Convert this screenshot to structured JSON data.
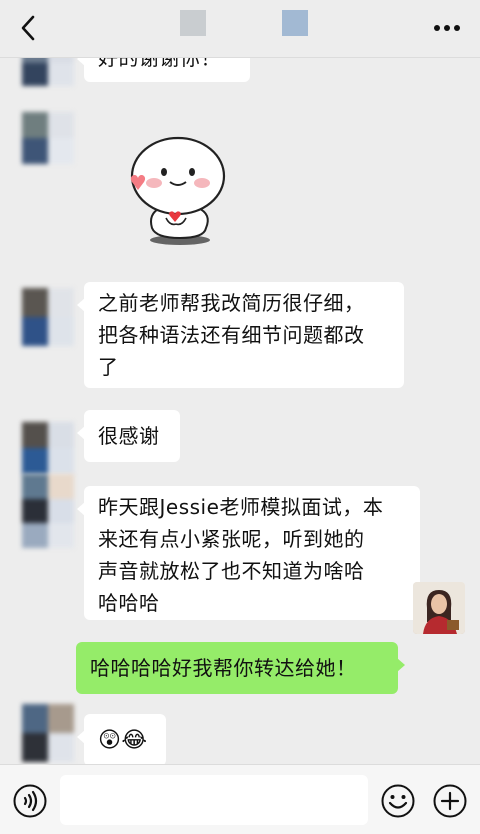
{
  "header": {
    "back_icon": "chevron-left-icon",
    "more_icon": "ellipsis-icon"
  },
  "messages": [
    {
      "side": "left",
      "type": "text",
      "text": "好的谢谢你！"
    },
    {
      "side": "left",
      "type": "sticker",
      "sticker": "cute-bun-heart-sticker"
    },
    {
      "side": "left",
      "type": "text",
      "text": "之前老师帮我改简历很仔细，把各种语法还有细节问题都改了"
    },
    {
      "side": "left",
      "type": "text",
      "text": "很感谢"
    },
    {
      "side": "left",
      "type": "text",
      "text": "昨天跟Jessie老师模拟面试，本来还有点小紧张呢，听到她的声音就放松了也不知道为啥哈哈哈哈"
    },
    {
      "side": "right",
      "type": "text",
      "text": "哈哈哈哈好我帮你转达给她！"
    },
    {
      "side": "left",
      "type": "emoji",
      "text": "😲😂"
    }
  ],
  "bubble_lines": {
    "m0": [
      "好的谢谢你！"
    ],
    "m2": [
      "之前老师帮我改简历很仔细，",
      "把各种语法还有细节问题都改",
      "了"
    ],
    "m3": [
      "很感谢"
    ],
    "m4": [
      "昨天跟Jessie老师模拟面试，本",
      "来还有点小紧张呢，听到她的",
      "声音就放松了也不知道为啥哈",
      "哈哈哈"
    ],
    "m5": [
      "哈哈哈哈好我帮你转达给她！"
    ],
    "m6": [
      "😲😂"
    ]
  },
  "input_bar": {
    "message_value": "",
    "voice_icon": "voice-icon",
    "emoji_icon": "emoji-icon",
    "plus_icon": "plus-icon"
  },
  "colors": {
    "background": "#ededed",
    "bubble_left": "#ffffff",
    "bubble_right": "#95ec69"
  }
}
